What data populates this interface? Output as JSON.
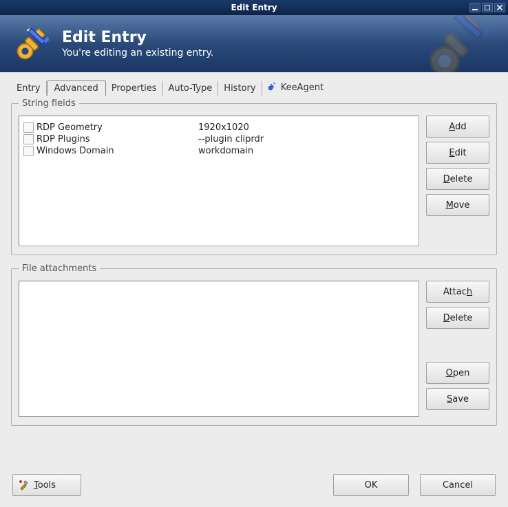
{
  "window": {
    "title": "Edit Entry"
  },
  "header": {
    "title": "Edit Entry",
    "subtitle": "You're editing an existing entry."
  },
  "tabs": [
    {
      "label": "Entry",
      "active": false
    },
    {
      "label": "Advanced",
      "active": true
    },
    {
      "label": "Properties",
      "active": false
    },
    {
      "label": "Auto-Type",
      "active": false
    },
    {
      "label": "History",
      "active": false
    },
    {
      "label": "KeeAgent",
      "active": false,
      "icon": "key"
    }
  ],
  "string_fields": {
    "legend": "String fields",
    "items": [
      {
        "name": "RDP Geometry",
        "value": "1920x1020"
      },
      {
        "name": "RDP Plugins",
        "value": "--plugin cliprdr"
      },
      {
        "name": "Windows Domain",
        "value": "workdomain"
      }
    ],
    "buttons": {
      "add": "Add",
      "edit": "Edit",
      "delete": "Delete",
      "move": "Move"
    }
  },
  "file_attachments": {
    "legend": "File attachments",
    "items": [],
    "buttons": {
      "attach": "Attach",
      "delete": "Delete",
      "open": "Open",
      "save": "Save"
    }
  },
  "footer": {
    "tools": "Tools",
    "ok": "OK",
    "cancel": "Cancel"
  }
}
